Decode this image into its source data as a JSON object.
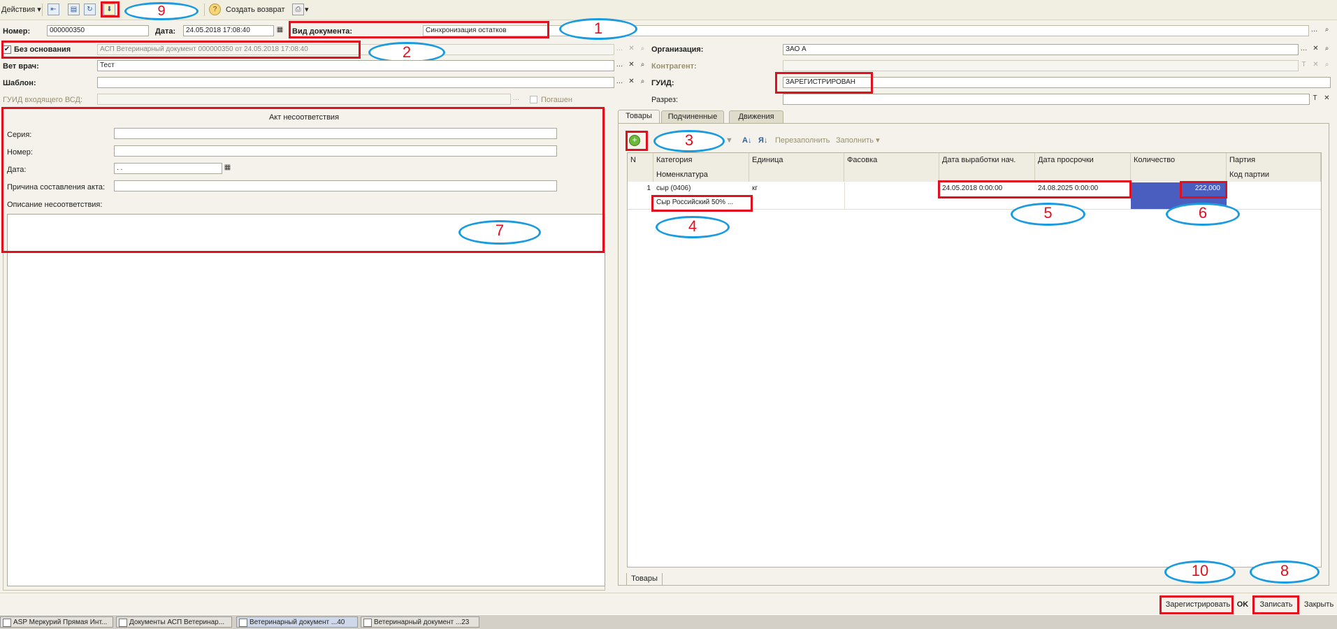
{
  "toolbar": {
    "actions_label": "Действия",
    "create_return_label": "Создать возврат",
    "help_icon": "question-icon",
    "print_icon": "printer-icon"
  },
  "header": {
    "number_label": "Номер:",
    "number_value": "000000350",
    "date_label": "Дата:",
    "date_value": "24.05.2018 17:08:40",
    "doc_type_label": "Вид документа:",
    "doc_type_value": "Синхронизация остатков"
  },
  "left": {
    "basis_label": "Без основания",
    "basis_value": "АСП Ветеринарный документ 000000350 от 24.05.2018 17:08:40",
    "vet_label": "Вет врач:",
    "vet_value": "Тест",
    "template_label": "Шаблон:",
    "template_value": "",
    "guid_in_label": "ГУИД входящего ВСД:",
    "paid_label": "Погашен"
  },
  "right": {
    "org_label": "Организация:",
    "org_value": "ЗАО   А",
    "contractor_label": "Контрагент:",
    "guid_label": "ГУИД:",
    "guid_value": "ЗАРЕГИСТРИРОВАН",
    "section_label": "Разрез:"
  },
  "act": {
    "title": "Акт несоответствия",
    "series_label": "Серия:",
    "number_label": "Номер:",
    "date_label": "Дата:",
    "date_value": " .  .",
    "reason_label": "Причина составления акта:",
    "desc_label": "Описание несоответствия:"
  },
  "tabs": {
    "goods": "Товары",
    "subordinate": "Подчиненные",
    "movements": "Движения",
    "bottom_goods": "Товары"
  },
  "grid_toolbar": {
    "refill": "Перезаполнить",
    "fill": "Заполнить"
  },
  "grid": {
    "headers": [
      "N",
      "Категория",
      "Единица",
      "Фасовка",
      "Дата выработки нач.",
      "Дата просрочки",
      "Количество",
      "Партия"
    ],
    "subheaders": [
      "Номенклатура",
      "Код партии"
    ],
    "row": {
      "n": "1",
      "category": "сыр (0406)",
      "nomenclature": "Сыр Российский 50% ...",
      "unit": "кг",
      "date_start": "24.05.2018 0:00:00",
      "date_exp": "24.08.2025 0:00:00",
      "qty": "222,000"
    }
  },
  "buttons": {
    "register": "Зарегистрировать",
    "ok": "OK",
    "save": "Записать",
    "close": "Закрыть"
  },
  "callouts": [
    "1",
    "2",
    "3",
    "4",
    "5",
    "6",
    "7",
    "8",
    "9",
    "10"
  ],
  "taskbar": [
    "ASP Меркурий Прямая Инт...",
    "Документы АСП Ветеринар...",
    "Ветеринарный документ ...40",
    "Ветеринарный документ ...23"
  ],
  "colors": {
    "annotation_red": "#e0101e",
    "annotation_blue": "#1a9be0",
    "selection": "#4a5ec0"
  }
}
